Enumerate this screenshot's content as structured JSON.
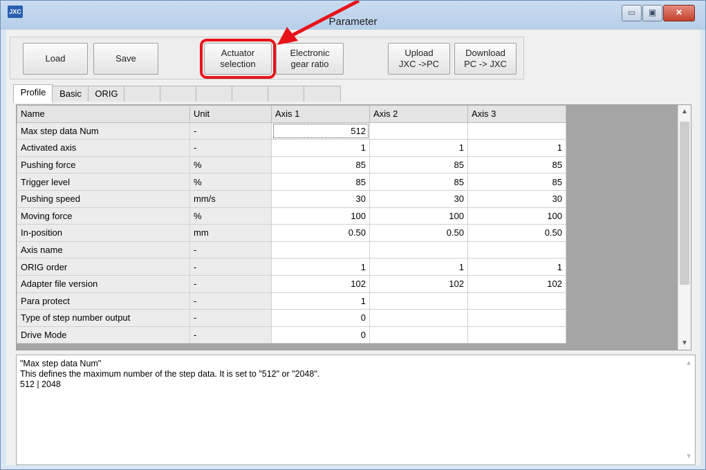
{
  "window": {
    "app_icon_text": "JXC",
    "title": "Parameter",
    "controls": {
      "minimize": "▭",
      "maximize": "▣",
      "close": "✕"
    }
  },
  "toolbar": {
    "load": "Load",
    "save": "Save",
    "actuator_selection": "Actuator\nselection",
    "electronic_gear_ratio": "Electronic\ngear ratio",
    "upload": "Upload\nJXC ->PC",
    "download": "Download\nPC -> JXC"
  },
  "tabs": [
    "Profile",
    "Basic",
    "ORIG",
    "",
    "",
    "",
    "",
    "",
    ""
  ],
  "table": {
    "headers": [
      "Name",
      "Unit",
      "Axis 1",
      "Axis 2",
      "Axis 3"
    ],
    "rows": [
      [
        "Max step data Num",
        "-",
        "512",
        "",
        ""
      ],
      [
        "Activated axis",
        "-",
        "1",
        "1",
        "1"
      ],
      [
        "Pushing force",
        "%",
        "85",
        "85",
        "85"
      ],
      [
        "Trigger level",
        "%",
        "85",
        "85",
        "85"
      ],
      [
        "Pushing speed",
        "mm/s",
        "30",
        "30",
        "30"
      ],
      [
        "Moving force",
        "%",
        "100",
        "100",
        "100"
      ],
      [
        "In-position",
        "mm",
        "0.50",
        "0.50",
        "0.50"
      ],
      [
        "Axis name",
        "-",
        "",
        "",
        ""
      ],
      [
        "ORIG order",
        "-",
        "1",
        "1",
        "1"
      ],
      [
        "Adapter file version",
        "-",
        "102",
        "102",
        "102"
      ],
      [
        "Para protect",
        "-",
        "1",
        "",
        ""
      ],
      [
        "Type of step number output",
        "-",
        "0",
        "",
        ""
      ],
      [
        "Drive Mode",
        "-",
        "0",
        "",
        ""
      ]
    ]
  },
  "description": {
    "title": "\"Max step data Num\"",
    "text": "This defines the maximum number of the step data. It is set to \"512\" or \"2048\".",
    "options": "512 | 2048"
  },
  "colors": {
    "highlight": "#e8131a",
    "grid_filler": "#a5a5a5"
  }
}
